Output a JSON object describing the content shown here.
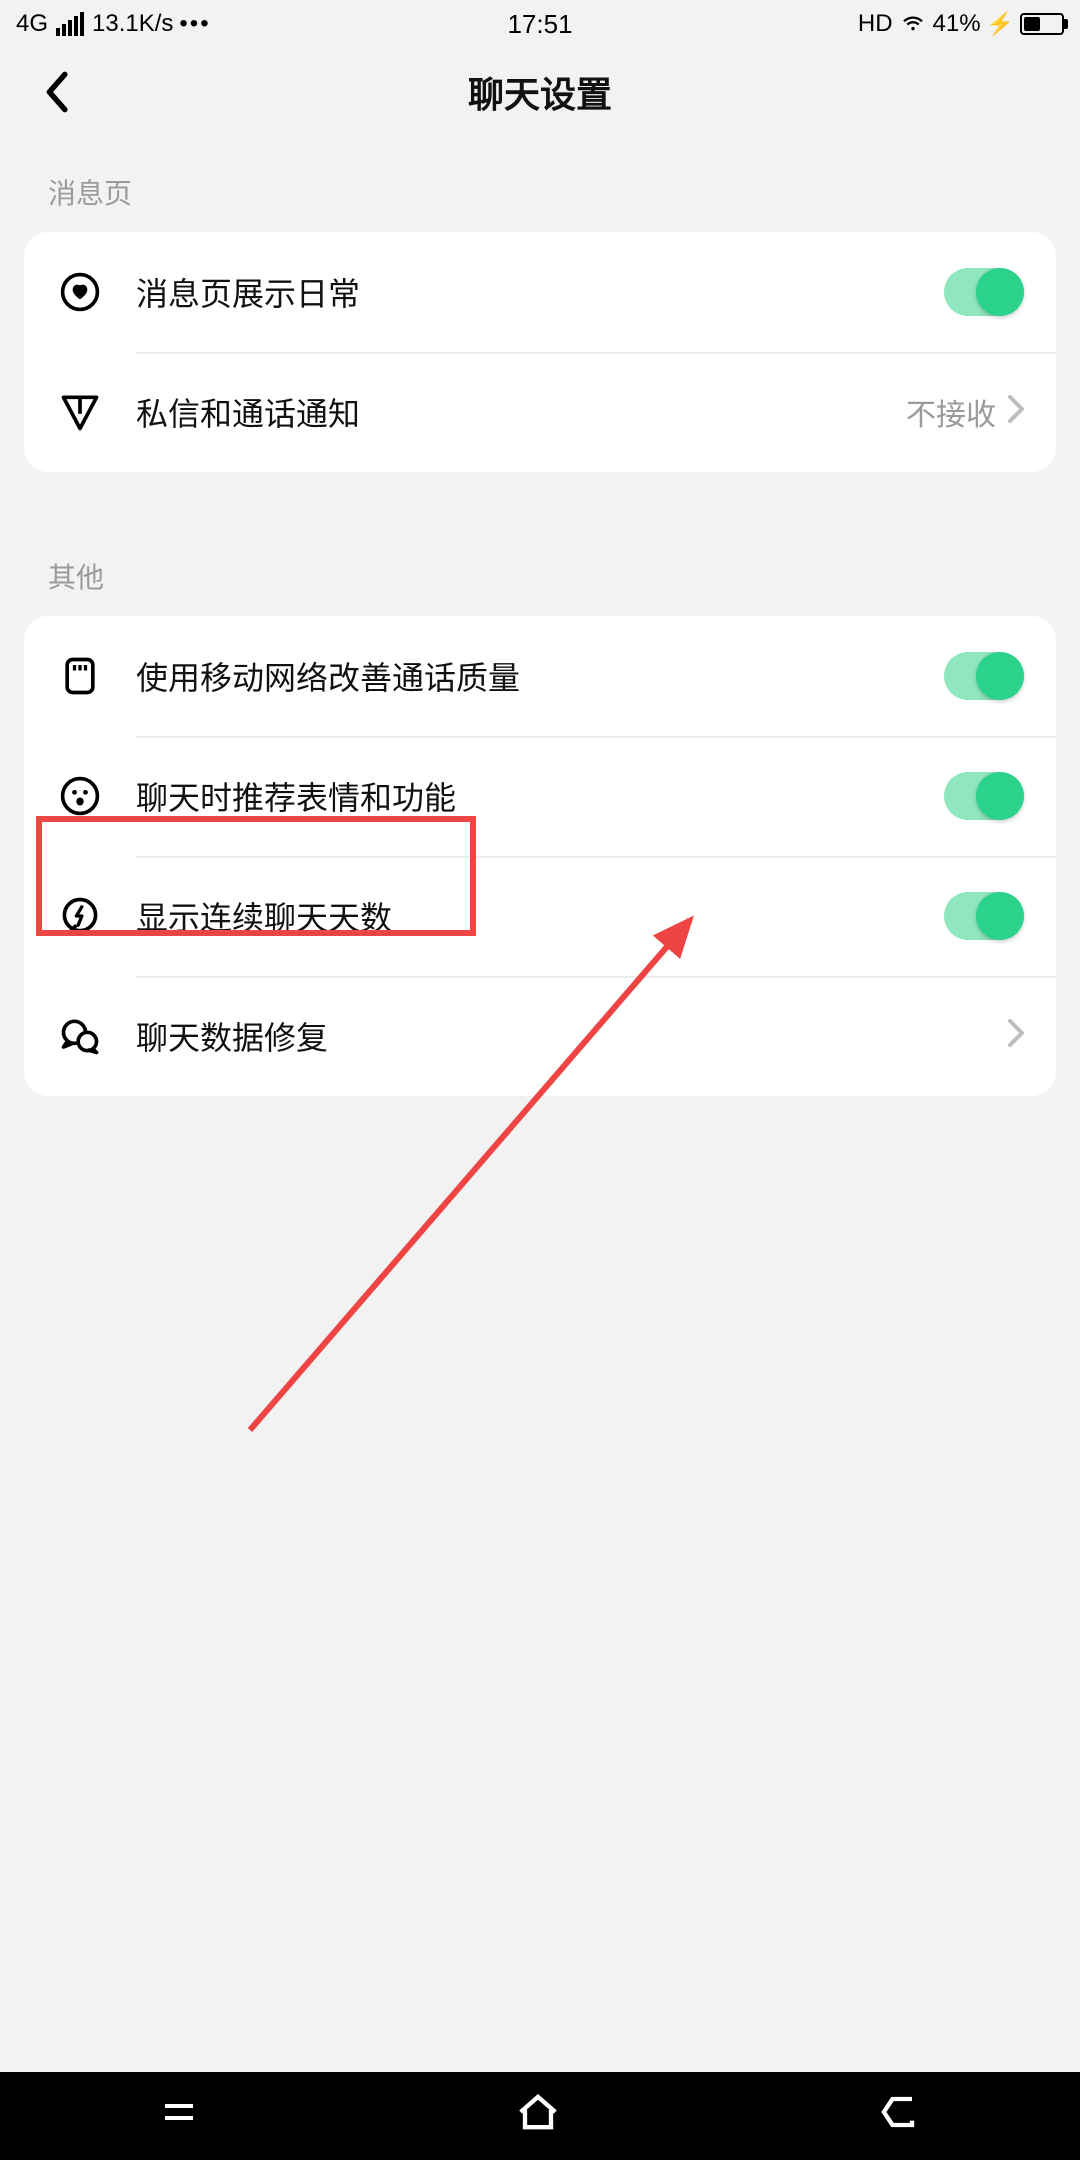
{
  "status": {
    "network": "4G",
    "speed": "13.1K/s",
    "time": "17:51",
    "hd": "HD",
    "battery_pct": "41%"
  },
  "header": {
    "title": "聊天设置"
  },
  "sections": {
    "messages": {
      "header": "消息页",
      "row_daily": {
        "label": "消息页展示日常",
        "on": true
      },
      "row_dm": {
        "label": "私信和通话通知",
        "value": "不接收"
      }
    },
    "other": {
      "header": "其他",
      "row_cellular": {
        "label": "使用移动网络改善通话质量",
        "on": true
      },
      "row_emoji": {
        "label": "聊天时推荐表情和功能",
        "on": true
      },
      "row_streak": {
        "label": "显示连续聊天天数",
        "on": true
      },
      "row_repair": {
        "label": "聊天数据修复"
      }
    }
  },
  "colors": {
    "toggle_on_track": "#8fe6bf",
    "toggle_on_knob": "#2ad28b",
    "highlight": "#ef4444"
  }
}
